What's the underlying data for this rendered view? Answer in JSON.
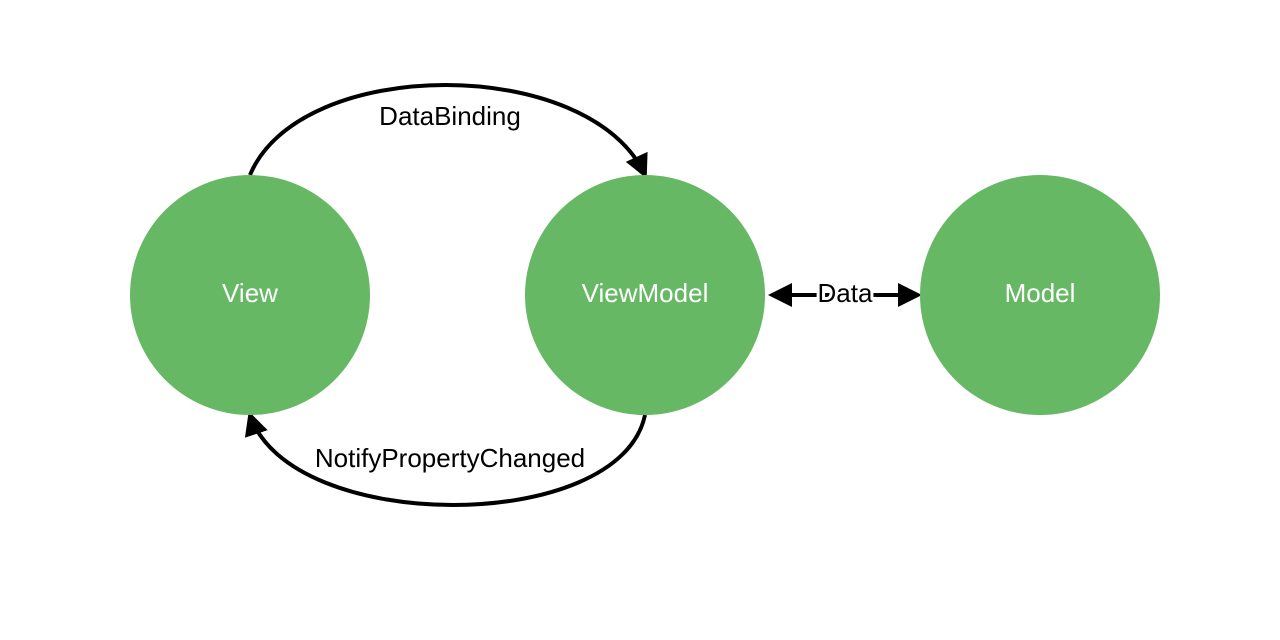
{
  "diagram": {
    "nodes": {
      "view": {
        "label": "View"
      },
      "viewmodel": {
        "label": "ViewModel"
      },
      "model": {
        "label": "Model"
      }
    },
    "edges": {
      "databinding": {
        "label": "DataBinding"
      },
      "notify": {
        "label": "NotifyPropertyChanged"
      },
      "data": {
        "label": "Data"
      }
    },
    "colors": {
      "node_fill": "#67B865",
      "node_text": "#ffffff",
      "edge": "#000000"
    }
  }
}
